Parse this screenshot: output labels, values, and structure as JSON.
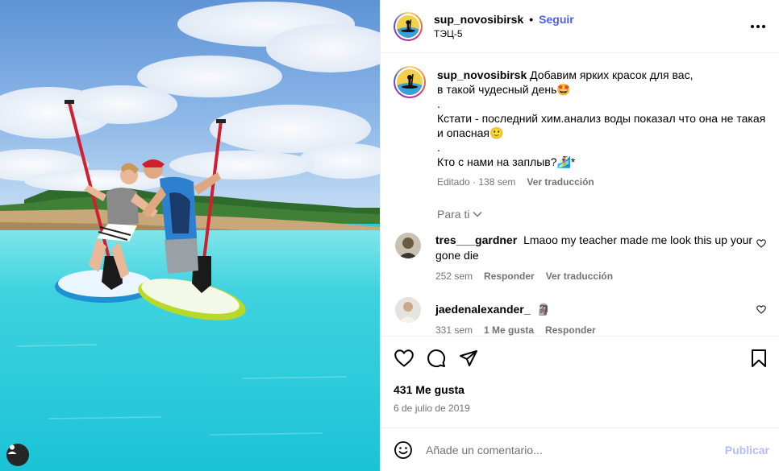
{
  "post": {
    "username": "sup_novosibirsk",
    "separator": "•",
    "follow_label": "Seguir",
    "location": "ТЭЦ-5",
    "caption": {
      "username": "sup_novosibirsk",
      "line1": "Добавим ярких красок для вас,",
      "line2": "в такой чудесный день🤩",
      "line3": ".",
      "line4": "Кстати - последний хим.анализ воды показал что она не такая и опасная🙂",
      "line5": ".",
      "line6": "Кто с нами на заплыв?🏄‍♀️*",
      "time": "Editado · 138 sem",
      "translate": "Ver traducción"
    },
    "para_ti": "Para ti"
  },
  "comments": [
    {
      "username": "tres___gardner",
      "text": "Lmaoo my teacher made me look this up your gone die",
      "time": "252 sem",
      "reply": "Responder",
      "translate": "Ver traducción"
    },
    {
      "username": "jaedenalexander_",
      "text": "🗿",
      "time": "331 sem",
      "likes": "1 Me gusta",
      "reply": "Responder"
    }
  ],
  "footer": {
    "likes": "431 Me gusta",
    "date": "6 de julio de 2019",
    "comment_placeholder": "Añade un comentario...",
    "publish_label": "Publicar"
  },
  "icons": {
    "like": "heart-icon",
    "comment": "comment-icon",
    "share": "paper-plane-icon",
    "save": "bookmark-icon",
    "more": "more-options-icon",
    "emoji": "emoji-icon",
    "chevron": "chevron-down-icon",
    "tag": "user-tag-icon"
  },
  "colors": {
    "accent": "#4a5df9",
    "muted": "#737373",
    "publish_disabled": "#b3bdfa",
    "water": "#2fcad8"
  }
}
